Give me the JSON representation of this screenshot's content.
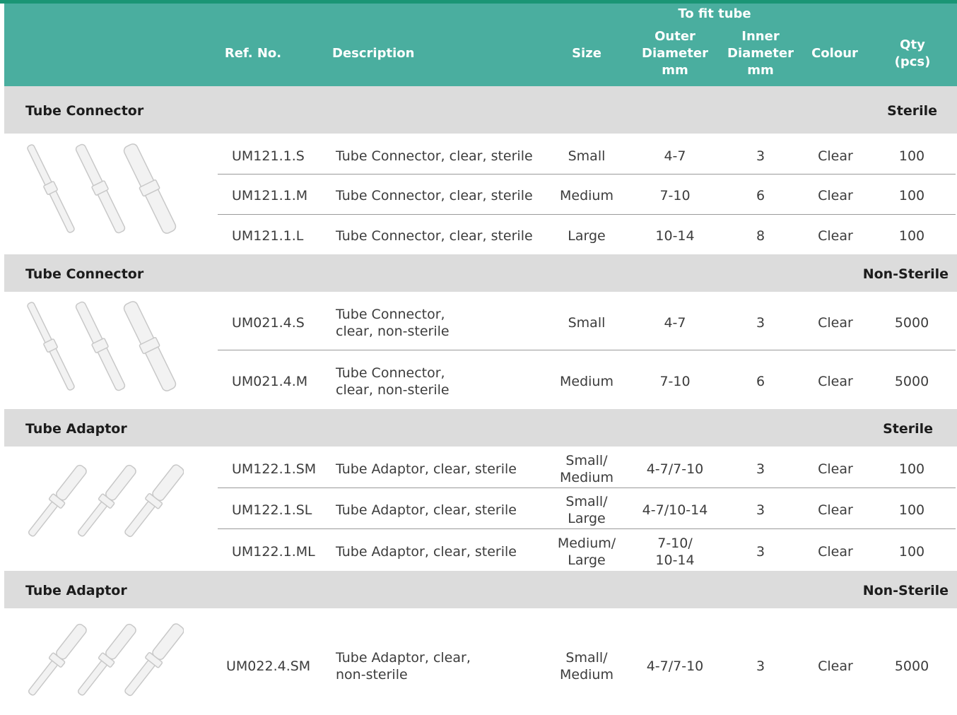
{
  "header": {
    "ref_no": "Ref. No.",
    "description": "Description",
    "size": "Size",
    "to_fit_tube": "To fit tube",
    "outer_diameter": [
      "Outer",
      "Diameter",
      "mm"
    ],
    "inner_diameter": [
      "Inner",
      "Diameter",
      "mm"
    ],
    "colour": "Colour",
    "qty": [
      "Qty",
      "(pcs)"
    ]
  },
  "sections": [
    {
      "title": "Tube Connector",
      "status": "Sterile",
      "rows": [
        {
          "ref": "UM121.1.S",
          "desc": [
            "Tube Connector, clear, sterile"
          ],
          "size": [
            "Small"
          ],
          "outer": [
            "4-7"
          ],
          "inner": "3",
          "colour": "Clear",
          "qty": "100"
        },
        {
          "ref": "UM121.1.M",
          "desc": [
            "Tube Connector, clear, sterile"
          ],
          "size": [
            "Medium"
          ],
          "outer": [
            "7-10"
          ],
          "inner": "6",
          "colour": "Clear",
          "qty": "100"
        },
        {
          "ref": "UM121.1.L",
          "desc": [
            "Tube Connector, clear, sterile"
          ],
          "size": [
            "Large"
          ],
          "outer": [
            "10-14"
          ],
          "inner": "8",
          "colour": "Clear",
          "qty": "100"
        }
      ]
    },
    {
      "title": "Tube Connector",
      "status": "Non-Sterile",
      "rows": [
        {
          "ref": "UM021.4.S",
          "desc": [
            "Tube Connector,",
            "clear, non-sterile"
          ],
          "size": [
            "Small"
          ],
          "outer": [
            "4-7"
          ],
          "inner": "3",
          "colour": "Clear",
          "qty": "5000"
        },
        {
          "ref": "UM021.4.M",
          "desc": [
            "Tube Connector,",
            "clear, non-sterile"
          ],
          "size": [
            "Medium"
          ],
          "outer": [
            "7-10"
          ],
          "inner": "6",
          "colour": "Clear",
          "qty": "5000"
        }
      ]
    },
    {
      "title": "Tube Adaptor",
      "status": "Sterile",
      "rows": [
        {
          "ref": "UM122.1.SM",
          "desc": [
            "Tube Adaptor, clear, sterile"
          ],
          "size": [
            "Small/",
            "Medium"
          ],
          "outer": [
            "4-7/7-10"
          ],
          "inner": "3",
          "colour": "Clear",
          "qty": "100"
        },
        {
          "ref": "UM122.1.SL",
          "desc": [
            "Tube Adaptor, clear, sterile"
          ],
          "size": [
            "Small/",
            "Large"
          ],
          "outer": [
            "4-7/10-14"
          ],
          "inner": "3",
          "colour": "Clear",
          "qty": "100"
        },
        {
          "ref": "UM122.1.ML",
          "desc": [
            "Tube Adaptor, clear, sterile"
          ],
          "size": [
            "Medium/",
            "Large"
          ],
          "outer": [
            "7-10/",
            "10-14"
          ],
          "inner": "3",
          "colour": "Clear",
          "qty": "100"
        }
      ]
    },
    {
      "title": "Tube Adaptor",
      "status": "Non-Sterile",
      "rows": [
        {
          "ref": "UM022.4.SM",
          "desc": [
            "Tube Adaptor, clear,",
            "non-sterile"
          ],
          "size": [
            "Small/",
            "Medium"
          ],
          "outer": [
            "4-7/7-10"
          ],
          "inner": "3",
          "colour": "Clear",
          "qty": "5000"
        }
      ]
    }
  ],
  "colors": {
    "accent_line": "#1a9575",
    "header_bg": "#4aae9f",
    "section_bg": "#dcdcdc"
  }
}
